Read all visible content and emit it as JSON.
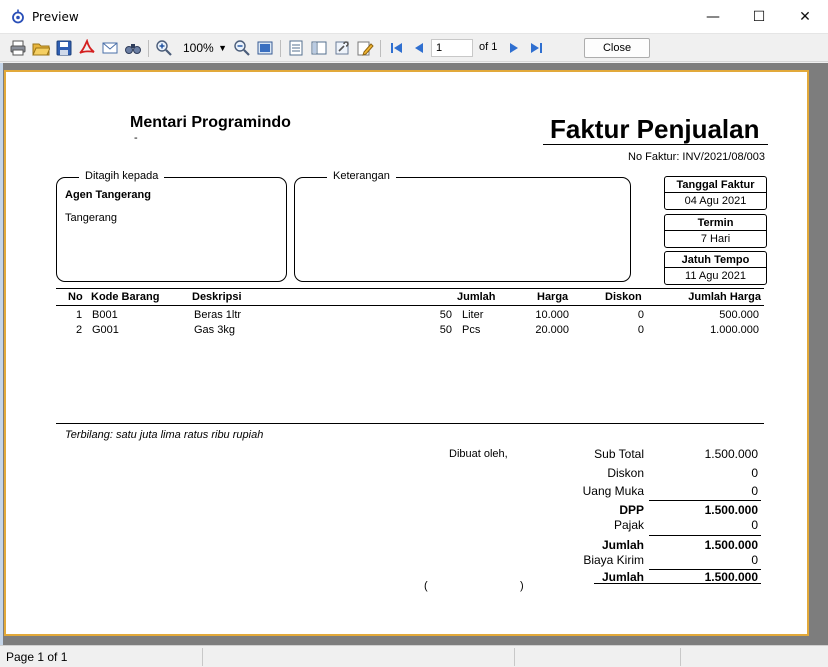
{
  "window": {
    "title": "Preview",
    "minimize_glyph": "—",
    "maximize_glyph": "☐",
    "close_glyph": "✕"
  },
  "toolbar": {
    "zoom": "100%",
    "page_input": "1",
    "page_of": "of 1",
    "close_label": "Close",
    "icons": [
      "print-icon",
      "open-icon",
      "save-icon",
      "pdf-icon",
      "email-icon",
      "find-icon",
      "zoom-in-icon",
      "zoom-out-icon",
      "page-width-icon",
      "page-setup-icon",
      "outline-icon",
      "tools-icon",
      "edit-icon",
      "first-page-icon",
      "prev-page-icon",
      "next-page-icon",
      "last-page-icon"
    ]
  },
  "invoice": {
    "company": "Mentari Programindo",
    "company_sub": "-",
    "title": "Faktur Penjualan",
    "number": "No Faktur: INV/2021/08/003",
    "bill_to_label": "Ditagih kepada",
    "bill_to_name": "Agen Tangerang",
    "bill_to_city": "Tangerang",
    "notes_label": "Keterangan",
    "invoice_date_label": "Tanggal Faktur",
    "invoice_date": "04 Agu 2021",
    "term_label": "Termin",
    "term": "7 Hari",
    "due_label": "Jatuh Tempo",
    "due_date": "11 Agu 2021",
    "columns": {
      "no": "No",
      "code": "Kode Barang",
      "desc": "Deskripsi",
      "qty": "Jumlah",
      "price": "Harga",
      "discount": "Diskon",
      "amount": "Jumlah Harga"
    },
    "rows": [
      {
        "no": "1",
        "code": "B001",
        "desc": "Beras 1ltr",
        "qty": "50",
        "unit": "Liter",
        "price": "10.000",
        "discount": "0",
        "amount": "500.000"
      },
      {
        "no": "2",
        "code": "G001",
        "desc": "Gas 3kg",
        "qty": "50",
        "unit": "Pcs",
        "price": "20.000",
        "discount": "0",
        "amount": "1.000.000"
      }
    ],
    "terbilang": "Terbilang: satu juta lima ratus ribu rupiah",
    "made_by": "Dibuat oleh,",
    "sign_open": "(",
    "sign_close": ")",
    "totals": {
      "subtotal_label": "Sub Total",
      "subtotal": "1.500.000",
      "discount_label": "Diskon",
      "discount": "0",
      "dp_label": "Uang Muka",
      "dp": "0",
      "dpp_label": "DPP",
      "dpp": "1.500.000",
      "tax_label": "Pajak",
      "tax": "0",
      "total1_label": "Jumlah",
      "total1": "1.500.000",
      "shipping_label": "Biaya Kirim",
      "shipping": "0",
      "total2_label": "Jumlah",
      "total2": "1.500.000"
    }
  },
  "status": {
    "page": "Page 1 of 1"
  }
}
